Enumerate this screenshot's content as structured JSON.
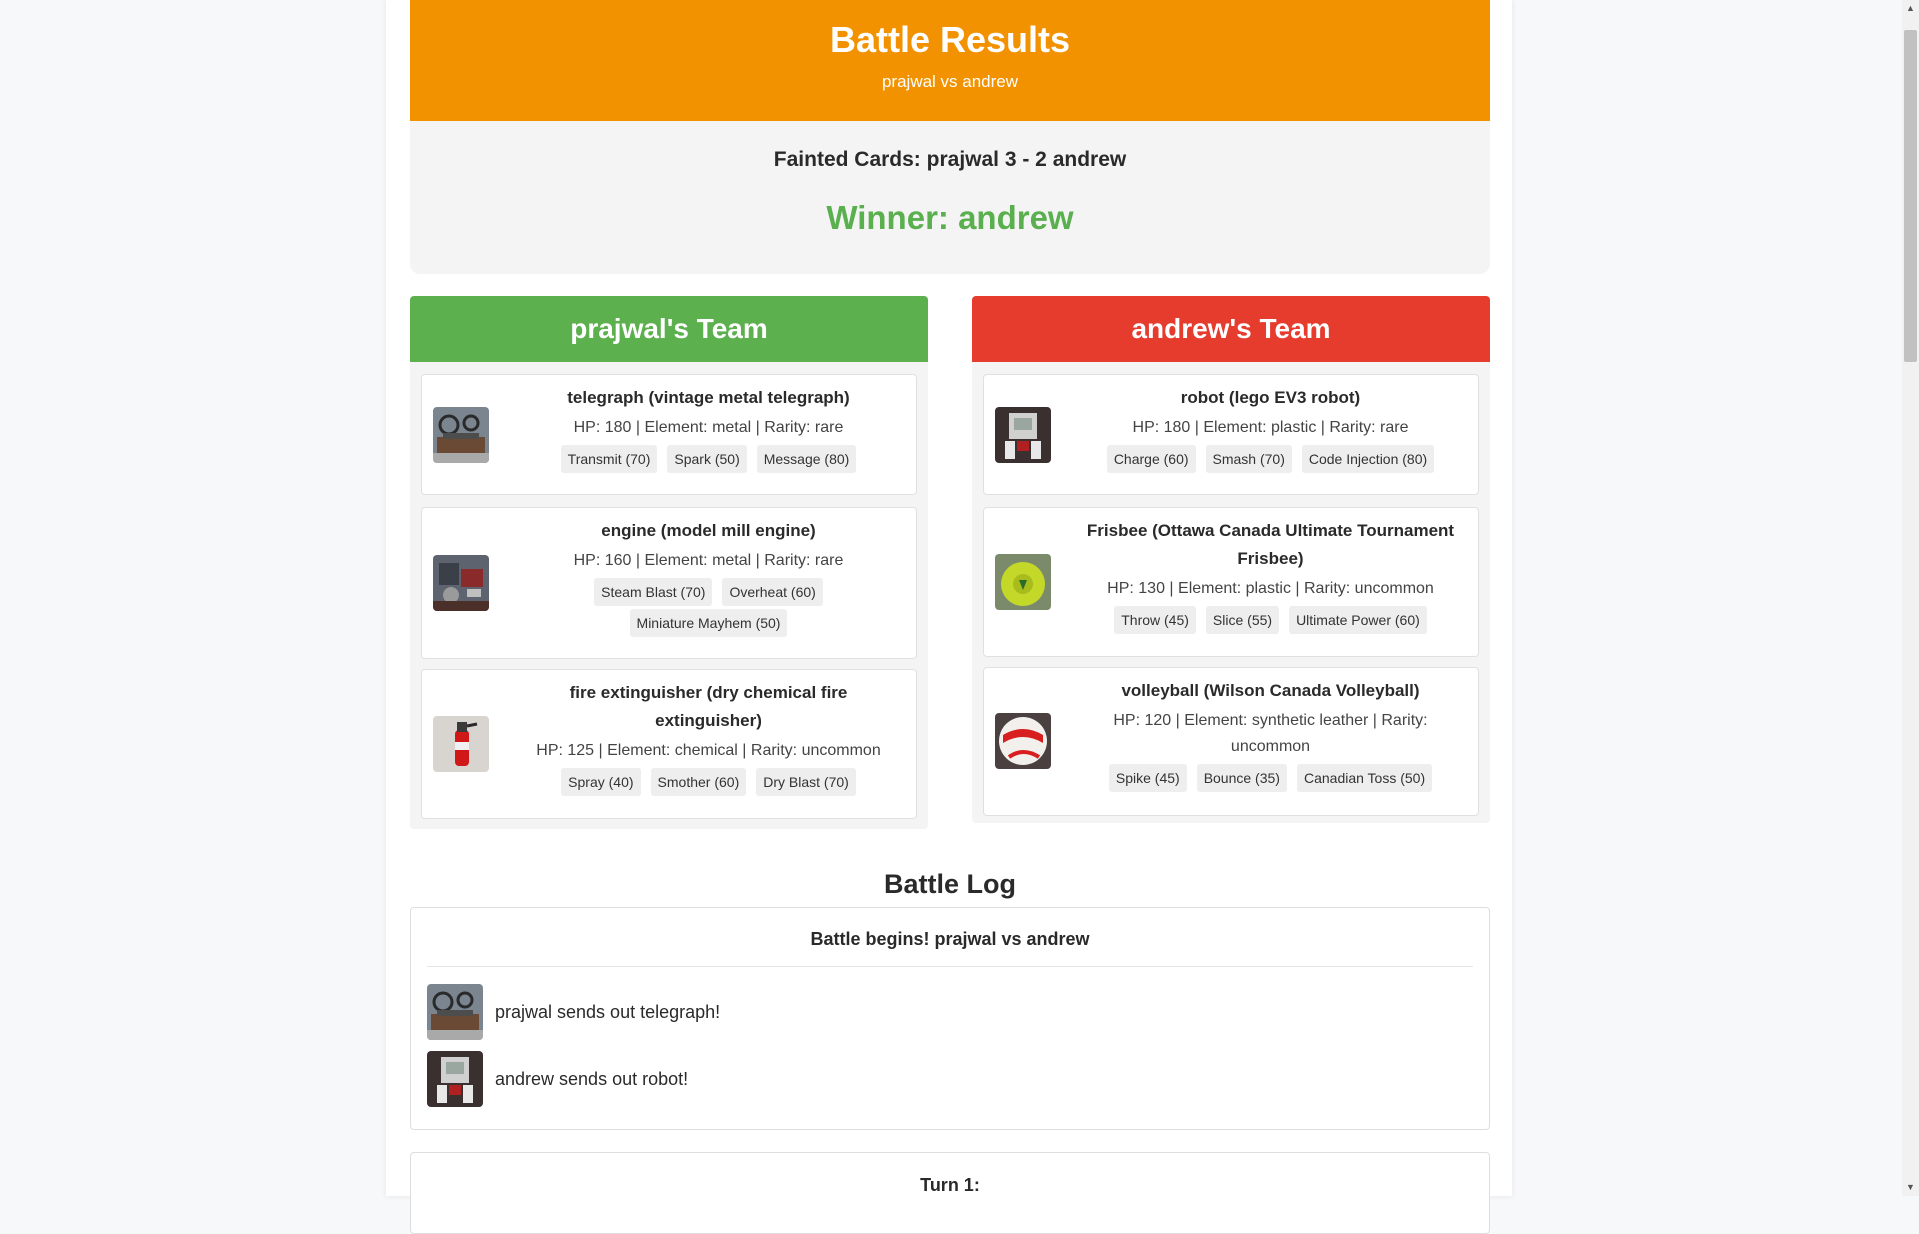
{
  "header": {
    "title": "Battle Results",
    "subtitle": "prajwal vs andrew"
  },
  "summary": {
    "fainted": "Fainted Cards: prajwal 3 - 2 andrew",
    "winner": "Winner: andrew"
  },
  "colors": {
    "header": "#f39200",
    "left_team": "#5cb04d",
    "right_team": "#e53c2e",
    "winner": "#5aaf4f"
  },
  "teams": [
    {
      "title": "prajwal's Team",
      "cards": [
        {
          "name": "telegraph (vintage metal telegraph)",
          "stats": "HP: 180 | Element: metal | Rarity: rare",
          "moves": [
            "Transmit (70)",
            "Spark (50)",
            "Message (80)"
          ]
        },
        {
          "name": "engine (model mill engine)",
          "stats": "HP: 160 | Element: metal | Rarity: rare",
          "moves": [
            "Steam Blast (70)",
            "Overheat (60)",
            "Miniature Mayhem (50)"
          ]
        },
        {
          "name": "fire extinguisher (dry chemical fire extinguisher)",
          "stats": "HP: 125 | Element: chemical | Rarity: uncommon",
          "moves": [
            "Spray (40)",
            "Smother (60)",
            "Dry Blast (70)"
          ]
        }
      ]
    },
    {
      "title": "andrew's Team",
      "cards": [
        {
          "name": "robot (lego EV3 robot)",
          "stats": "HP: 180 | Element: plastic | Rarity: rare",
          "moves": [
            "Charge (60)",
            "Smash (70)",
            "Code Injection (80)"
          ]
        },
        {
          "name": "Frisbee (Ottawa Canada Ultimate Tournament Frisbee)",
          "stats": "HP: 130 | Element: plastic | Rarity: uncommon",
          "moves": [
            "Throw (45)",
            "Slice (55)",
            "Ultimate Power (60)"
          ]
        },
        {
          "name": "volleyball (Wilson Canada Volleyball)",
          "stats": "HP: 120 | Element: synthetic leather | Rarity: uncommon",
          "moves": [
            "Spike (45)",
            "Bounce (35)",
            "Canadian Toss (50)"
          ]
        }
      ]
    }
  ],
  "battle_log": {
    "title": "Battle Log",
    "intro": "Battle begins! prajwal vs andrew",
    "entries": [
      "prajwal sends out telegraph!",
      "andrew sends out robot!"
    ],
    "next_turn": "Turn 1:"
  }
}
